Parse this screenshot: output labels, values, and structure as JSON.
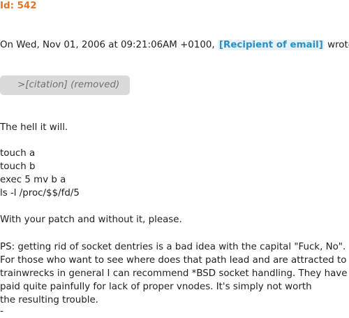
{
  "message": {
    "id_label": "Id: 542",
    "header_prefix": "On Wed, Nov 01, 2006 at 09:21:06AM +0100,",
    "recipient": "[Recipient of email]",
    "header_suffix": "wrote:",
    "citation": ">[citation] (removed)",
    "body": {
      "p1": "The hell it will.",
      "code": [
        "touch a",
        "touch b",
        "exec 5 mv b a",
        "ls -l /proc/$$/fd/5"
      ],
      "p2": "With your patch and without it, please.",
      "ps": [
        "PS: getting rid of socket dentries is a bad idea with the capital \"Fuck, No\".",
        "For those who want to see where does that path lead and are attracted to",
        "trainwrecks in general I can recommend *BSD socket handling. They have",
        "paid quite painfully for lack of proper vnodes. It's simply not worth",
        "the resulting trouble."
      ],
      "signature_sep": "-"
    }
  },
  "colors": {
    "id": "#e0742a",
    "recipient": "#2b8fc3",
    "citation_bg": "#dadada",
    "citation_text": "#707070"
  }
}
